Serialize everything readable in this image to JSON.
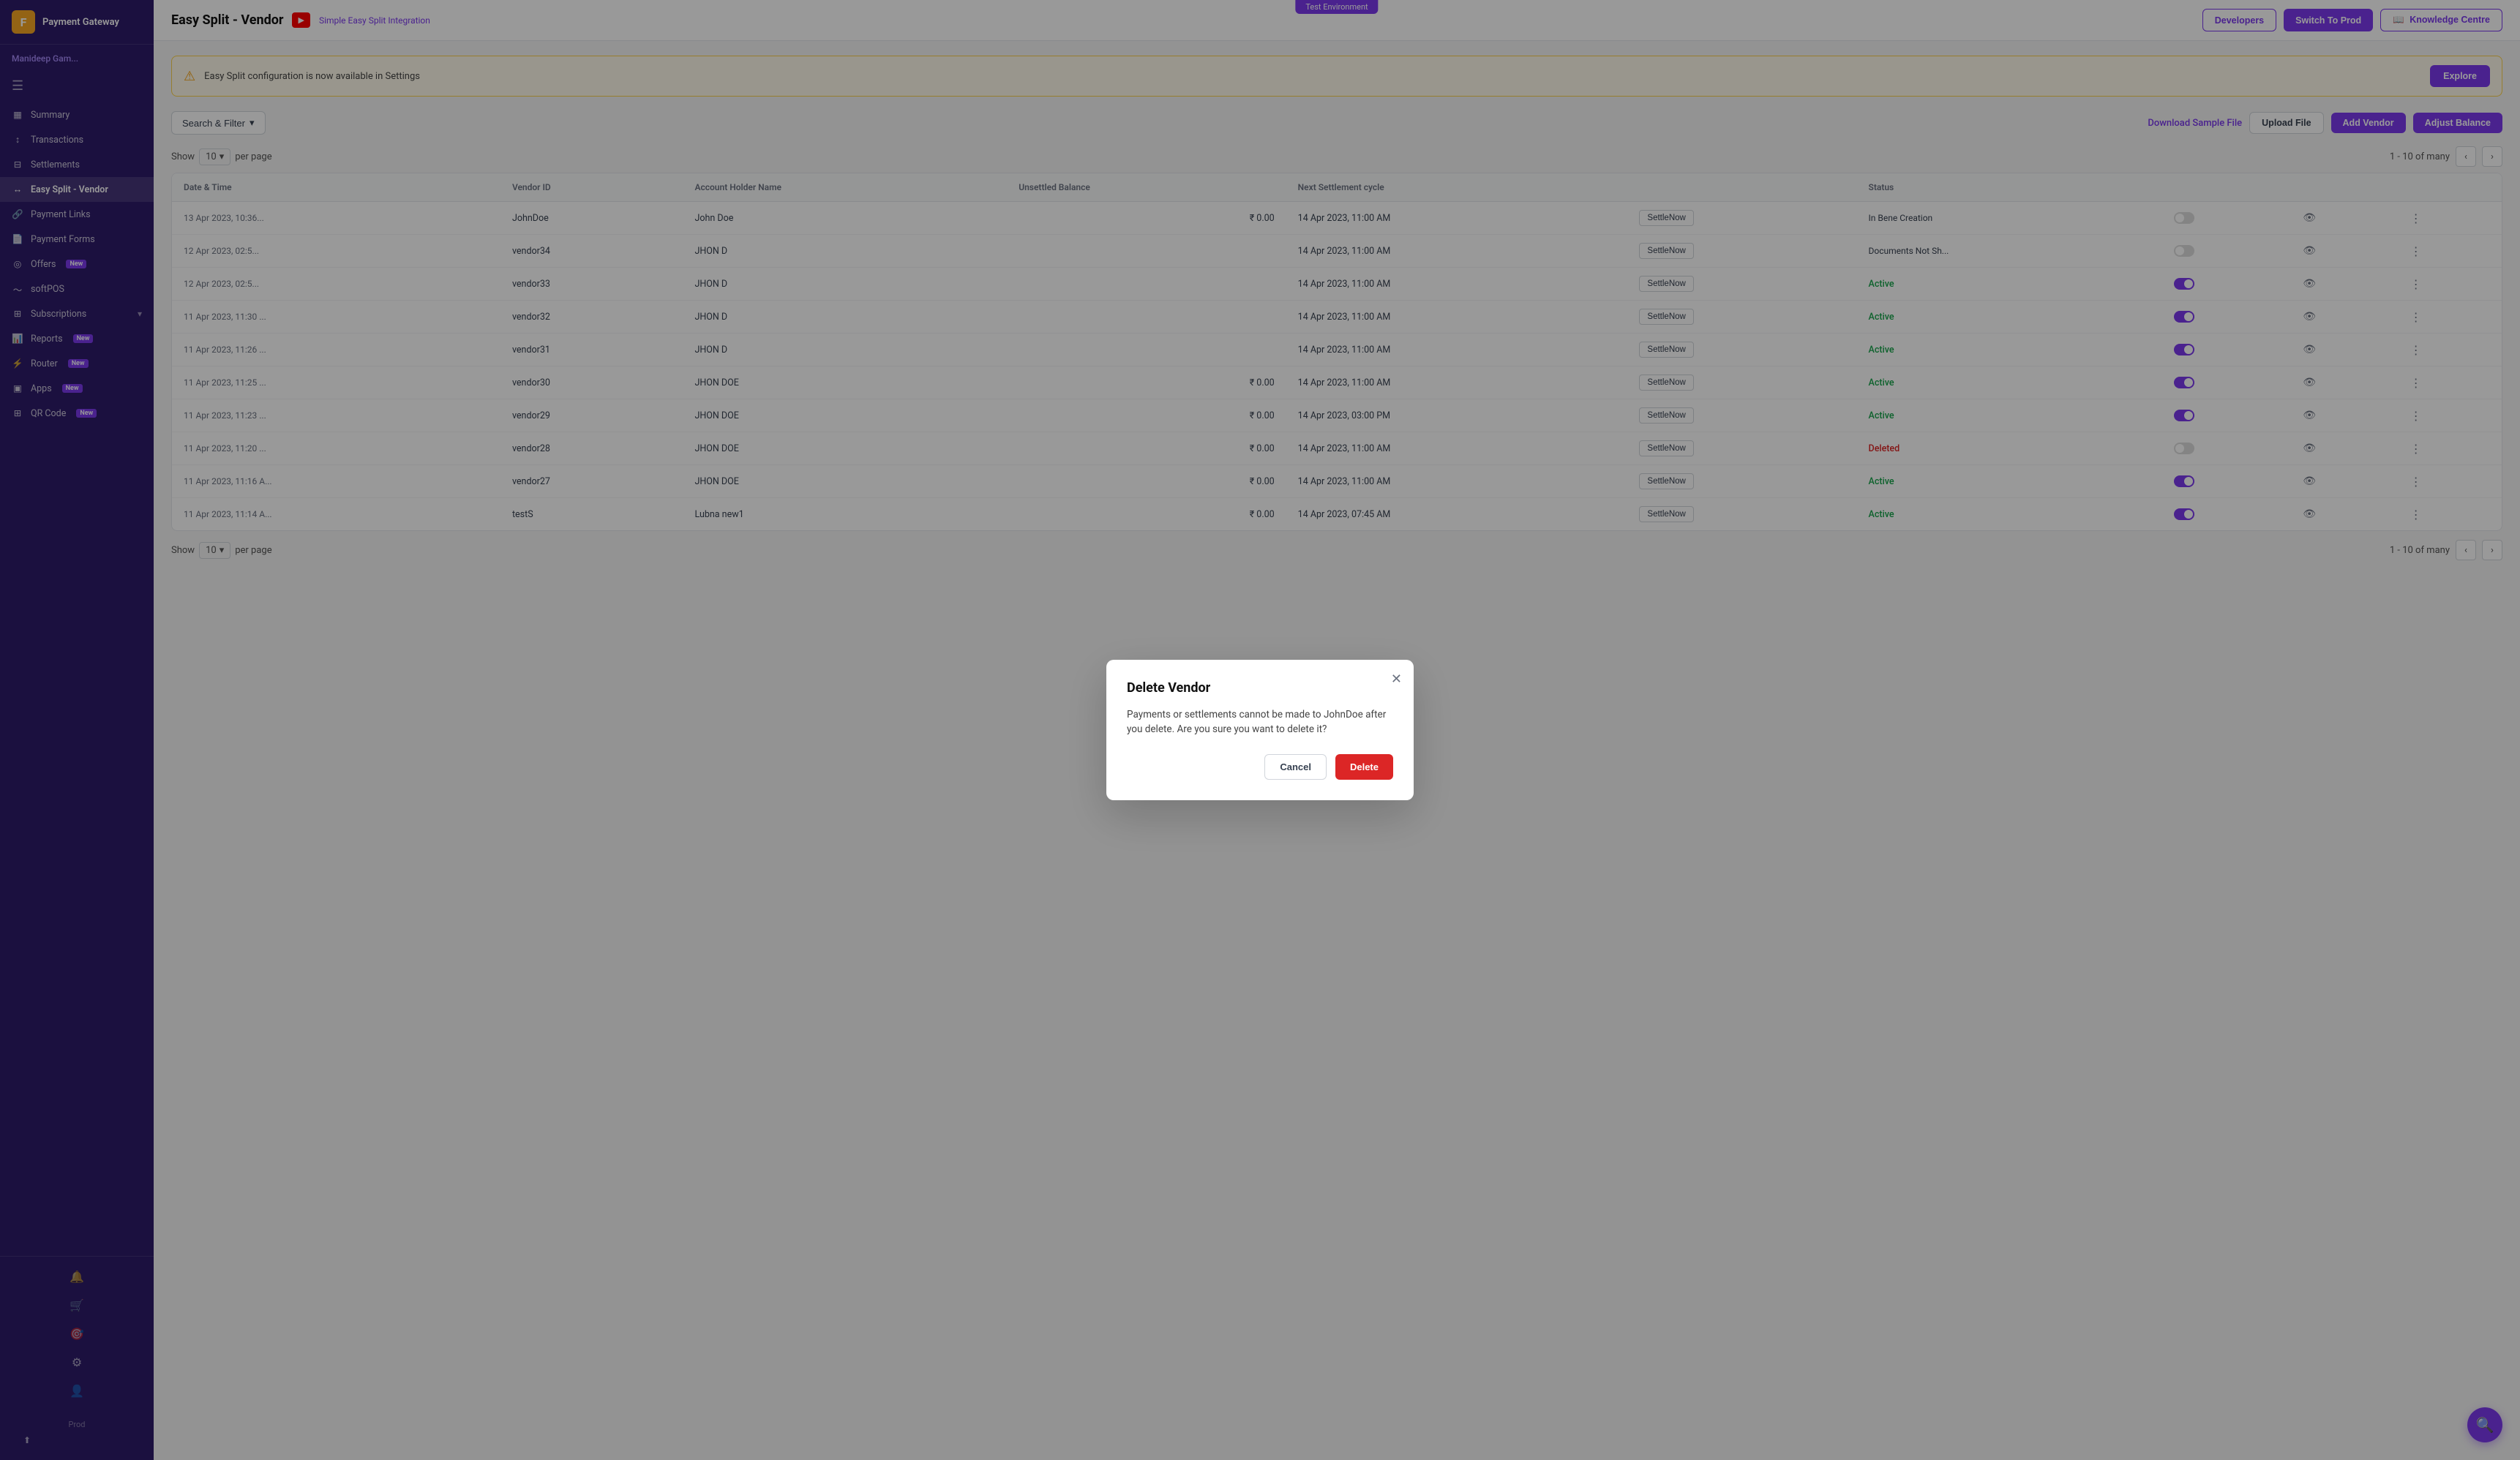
{
  "app": {
    "logo_letter": "F",
    "name": "Payment Gateway",
    "user": "Manideep Gam...",
    "env_badge": "Test Environment",
    "prod_label": "Prod"
  },
  "header": {
    "title": "Easy Split - Vendor",
    "youtube_label": "▶",
    "integration_link": "Simple Easy Split Integration",
    "developers_btn": "Developers",
    "switch_btn": "Switch To Prod",
    "knowledge_btn": "Knowledge Centre",
    "knowledge_icon": "📖"
  },
  "alert": {
    "text": "Easy Split configuration is now available in Settings",
    "explore_btn": "Explore"
  },
  "table_controls": {
    "filter_btn": "Search & Filter",
    "download_link": "Download Sample File",
    "upload_btn": "Upload File",
    "add_btn": "Add Vendor",
    "adjust_btn": "Adjust Balance"
  },
  "pagination": {
    "show_label": "Show",
    "per_page": "10",
    "per_page_label": "per page",
    "range": "1 - 10 of many"
  },
  "table": {
    "columns": [
      "Date & Time",
      "Vendor ID",
      "Account Holder Name",
      "Unsettled Balance",
      "Next Settlement cycle",
      "",
      "Status",
      "",
      "",
      ""
    ],
    "rows": [
      {
        "date": "13 Apr 2023, 10:36...",
        "vendor_id": "JohnDoe",
        "account_holder": "John Doe",
        "balance": "₹ 0.00",
        "next_settlement": "14 Apr 2023, 11:00 AM",
        "settle_btn": "SettleNow",
        "status": "In Bene Creation",
        "status_type": "bene",
        "toggle": false
      },
      {
        "date": "12 Apr 2023, 02:5...",
        "vendor_id": "vendor34",
        "account_holder": "JHON D",
        "balance": "",
        "next_settlement": "14 Apr 2023, 11:00 AM",
        "settle_btn": "SettleNow",
        "status": "Documents Not Sh...",
        "status_type": "docs",
        "toggle": false
      },
      {
        "date": "12 Apr 2023, 02:5...",
        "vendor_id": "vendor33",
        "account_holder": "JHON D",
        "balance": "",
        "next_settlement": "14 Apr 2023, 11:00 AM",
        "settle_btn": "SettleNow",
        "status": "Active",
        "status_type": "active",
        "toggle": true
      },
      {
        "date": "11 Apr 2023, 11:30 ...",
        "vendor_id": "vendor32",
        "account_holder": "JHON D",
        "balance": "",
        "next_settlement": "14 Apr 2023, 11:00 AM",
        "settle_btn": "SettleNow",
        "status": "Active",
        "status_type": "active",
        "toggle": true
      },
      {
        "date": "11 Apr 2023, 11:26 ...",
        "vendor_id": "vendor31",
        "account_holder": "JHON D",
        "balance": "",
        "next_settlement": "14 Apr 2023, 11:00 AM",
        "settle_btn": "SettleNow",
        "status": "Active",
        "status_type": "active",
        "toggle": true
      },
      {
        "date": "11 Apr 2023, 11:25 ...",
        "vendor_id": "vendor30",
        "account_holder": "JHON DOE",
        "balance": "₹ 0.00",
        "next_settlement": "14 Apr 2023, 11:00 AM",
        "settle_btn": "SettleNow",
        "status": "Active",
        "status_type": "active",
        "toggle": true
      },
      {
        "date": "11 Apr 2023, 11:23 ...",
        "vendor_id": "vendor29",
        "account_holder": "JHON DOE",
        "balance": "₹ 0.00",
        "next_settlement": "14 Apr 2023, 03:00 PM",
        "settle_btn": "SettleNow",
        "status": "Active",
        "status_type": "active",
        "toggle": true
      },
      {
        "date": "11 Apr 2023, 11:20 ...",
        "vendor_id": "vendor28",
        "account_holder": "JHON DOE",
        "balance": "₹ 0.00",
        "next_settlement": "14 Apr 2023, 11:00 AM",
        "settle_btn": "SettleNow",
        "status": "Deleted",
        "status_type": "deleted",
        "toggle": false
      },
      {
        "date": "11 Apr 2023, 11:16 A...",
        "vendor_id": "vendor27",
        "account_holder": "JHON DOE",
        "balance": "₹ 0.00",
        "next_settlement": "14 Apr 2023, 11:00 AM",
        "settle_btn": "SettleNow",
        "status": "Active",
        "status_type": "active",
        "toggle": true
      },
      {
        "date": "11 Apr 2023, 11:14 A...",
        "vendor_id": "testS",
        "account_holder": "Lubna new1",
        "balance": "₹ 0.00",
        "next_settlement": "14 Apr 2023, 07:45 AM",
        "settle_btn": "SettleNow",
        "status": "Active",
        "status_type": "active",
        "toggle": true
      }
    ]
  },
  "sidebar": {
    "items": [
      {
        "label": "Summary",
        "icon": "▦",
        "active": false
      },
      {
        "label": "Transactions",
        "icon": "↕",
        "active": false
      },
      {
        "label": "Settlements",
        "icon": "⊟",
        "active": false
      },
      {
        "label": "Easy Split - Vendor",
        "icon": "↔",
        "active": true
      },
      {
        "label": "Payment Links",
        "icon": "🔗",
        "active": false
      },
      {
        "label": "Payment Forms",
        "icon": "📄",
        "active": false
      },
      {
        "label": "Offers",
        "icon": "◎",
        "active": false,
        "badge": "New"
      },
      {
        "label": "softPOS",
        "icon": "〜",
        "active": false
      },
      {
        "label": "Subscriptions",
        "icon": "⊞",
        "active": false,
        "has_arrow": true
      },
      {
        "label": "Reports",
        "icon": "📊",
        "active": false,
        "badge": "New"
      },
      {
        "label": "Router",
        "icon": "⚡",
        "active": false,
        "badge": "New"
      },
      {
        "label": "Apps",
        "icon": "▣",
        "active": false,
        "badge": "New"
      },
      {
        "label": "QR Code",
        "icon": "⊞",
        "active": false,
        "badge": "New"
      }
    ]
  },
  "modal": {
    "title": "Delete Vendor",
    "body": "Payments or settlements cannot be made to JohnDoe after you delete. Are you sure you want to delete it?",
    "cancel_btn": "Cancel",
    "delete_btn": "Delete"
  }
}
